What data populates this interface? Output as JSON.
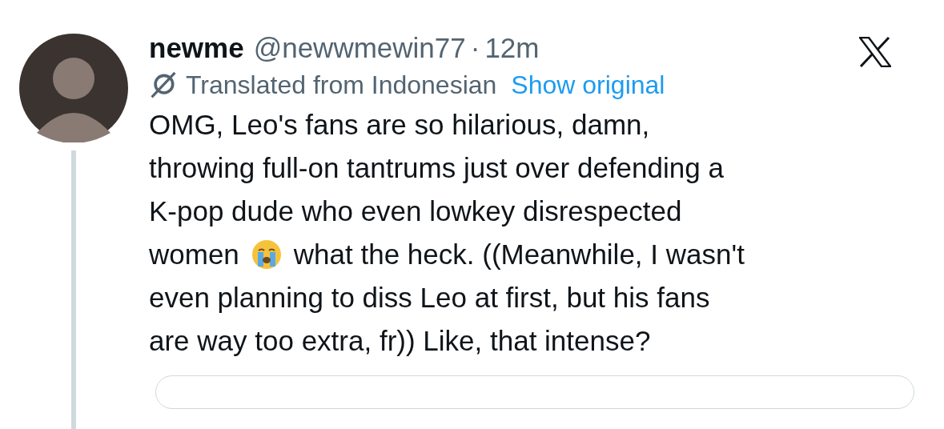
{
  "tweet": {
    "display_name": "newme",
    "handle": "@newwmewin77",
    "separator": "·",
    "time": "12m",
    "translation": {
      "label": "Translated from Indonesian",
      "link": "Show original"
    },
    "body_lines": [
      [
        {
          "kind": "text",
          "text": "OMG, Leo's fans are so hilarious, damn,"
        }
      ],
      [
        {
          "kind": "text",
          "text": "throwing full-on tantrums just over defending a"
        }
      ],
      [
        {
          "kind": "text",
          "text": "K-pop dude who even lowkey disrespected"
        }
      ],
      [
        {
          "kind": "text",
          "text": "women"
        },
        {
          "kind": "emoji"
        },
        {
          "kind": "text",
          "text": "what the heck. ((Meanwhile, I wasn't"
        }
      ],
      [
        {
          "kind": "text",
          "text": "even planning to diss Leo at first, but his fans"
        }
      ],
      [
        {
          "kind": "text",
          "text": "are way too extra, fr)) Like, that intense?"
        }
      ]
    ]
  }
}
